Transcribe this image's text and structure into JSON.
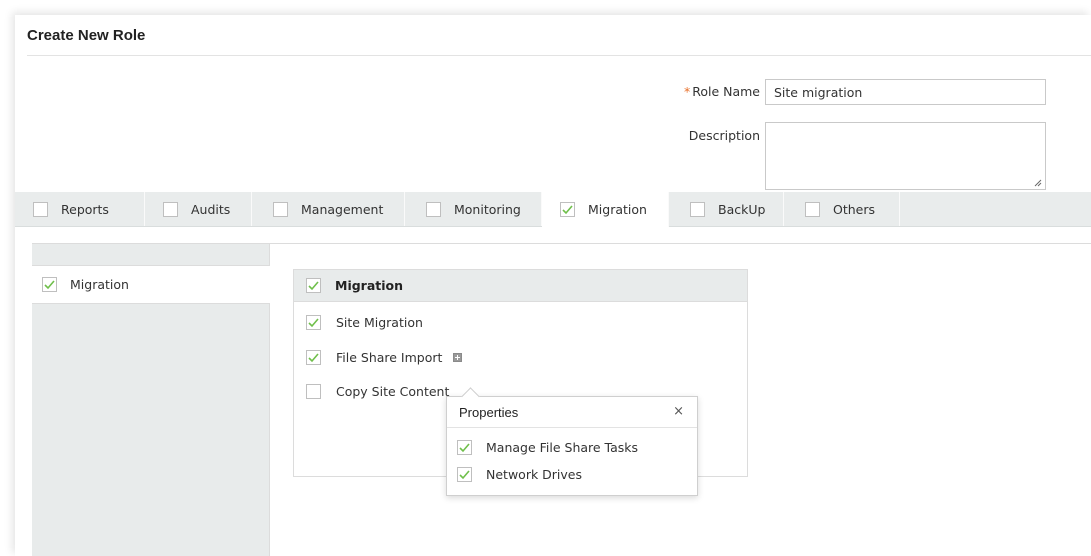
{
  "page": {
    "title": "Create New Role"
  },
  "form": {
    "role_name_label": "Role Name",
    "required_marker": "*",
    "role_name_value": "Site migration",
    "description_label": "Description",
    "description_value": ""
  },
  "tabs": [
    {
      "label": "Reports",
      "checked": false,
      "active": false
    },
    {
      "label": "Audits",
      "checked": false,
      "active": false
    },
    {
      "label": "Management",
      "checked": false,
      "active": false
    },
    {
      "label": "Monitoring",
      "checked": false,
      "active": false
    },
    {
      "label": "Migration",
      "checked": true,
      "active": true
    },
    {
      "label": "BackUp",
      "checked": false,
      "active": false
    },
    {
      "label": "Others",
      "checked": false,
      "active": false
    }
  ],
  "sidebar": {
    "items": [
      {
        "label": "Migration",
        "checked": true
      }
    ]
  },
  "permissions": {
    "header": {
      "label": "Migration",
      "checked": true
    },
    "rows": [
      {
        "label": "Site Migration",
        "checked": true
      },
      {
        "label": "File Share Import",
        "checked": true
      },
      {
        "label": "Copy Site Content",
        "checked": false
      }
    ]
  },
  "popup": {
    "title": "Properties",
    "close": "×",
    "items": [
      {
        "label": "Manage File Share Tasks",
        "checked": true
      },
      {
        "label": "Network Drives",
        "checked": true
      }
    ]
  },
  "colors": {
    "accent_check": "#6fbf4a",
    "required": "#e8702a"
  }
}
